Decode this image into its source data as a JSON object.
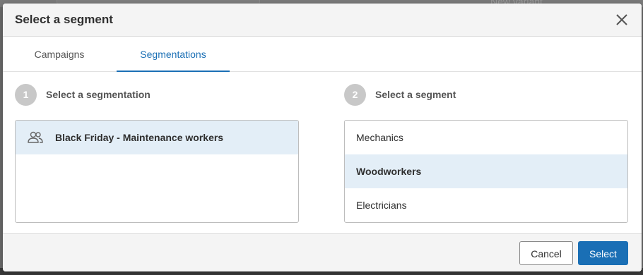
{
  "background": {
    "partial_text": "New variant"
  },
  "dialog": {
    "title": "Select a segment",
    "close_icon": "close-icon",
    "tabs": [
      {
        "label": "Campaigns",
        "active": false
      },
      {
        "label": "Segmentations",
        "active": true
      }
    ],
    "step1": {
      "number": "1",
      "label": "Select a segmentation"
    },
    "step2": {
      "number": "2",
      "label": "Select a segment"
    },
    "segmentations": [
      {
        "label": "Black Friday - Maintenance workers",
        "icon": "group-icon",
        "selected": true
      }
    ],
    "segments": [
      {
        "label": "Mechanics",
        "selected": false
      },
      {
        "label": "Woodworkers",
        "selected": true
      },
      {
        "label": "Electricians",
        "selected": false
      }
    ],
    "footer": {
      "cancel_label": "Cancel",
      "select_label": "Select"
    }
  },
  "colors": {
    "accent": "#1a6fb5",
    "selected_row": "#e3eef7",
    "step_circle": "#c8c8c8"
  }
}
